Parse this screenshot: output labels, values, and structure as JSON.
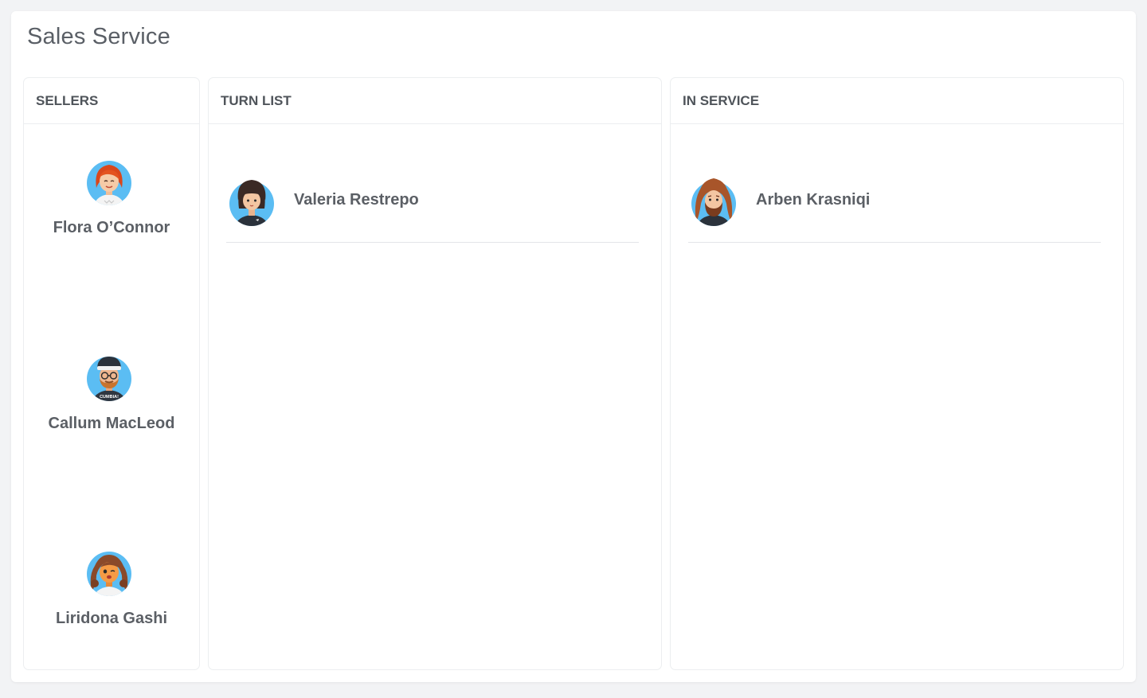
{
  "page": {
    "title": "Sales Service"
  },
  "panels": {
    "sellers": {
      "title": "SELLERS",
      "items": [
        {
          "name": "Flora O’Connor",
          "avatar_icon": "woman-red-hair-avatar-icon"
        },
        {
          "name": "Callum MacLeod",
          "avatar_icon": "man-glasses-beanie-avatar-icon",
          "shirt_text": "CUMBIA!"
        },
        {
          "name": "Liridona Gashi",
          "avatar_icon": "woman-curly-hair-winking-avatar-icon"
        }
      ]
    },
    "turn_list": {
      "title": "TURN LIST",
      "items": [
        {
          "name": "Valeria Restrepo",
          "avatar_icon": "woman-bob-hair-avatar-icon"
        }
      ]
    },
    "in_service": {
      "title": "IN SERVICE",
      "items": [
        {
          "name": "Arben Krasniqi",
          "avatar_icon": "man-long-hair-beard-avatar-icon"
        }
      ]
    }
  },
  "colors": {
    "background": "#f2f3f5",
    "card": "#ffffff",
    "avatar_bg": "#5bbdf3",
    "text": "#5b5f65"
  }
}
